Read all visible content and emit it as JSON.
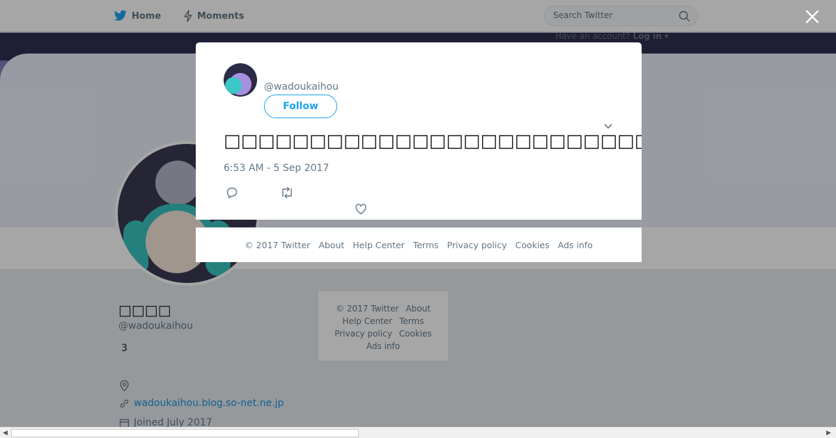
{
  "topnav": {
    "home_label": "Home",
    "moments_label": "Moments",
    "search_placeholder": "Search Twitter",
    "have_account": "Have an account?",
    "login_label": "Log in"
  },
  "profile": {
    "name": "□□□□",
    "handle": "@wadoukaihou",
    "count": "3",
    "url": "wadoukaihou.blog.so-net.ne.jp",
    "joined": "Joined July 2017"
  },
  "side_footer": {
    "copyright": "© 2017 Twitter",
    "about": "About",
    "help": "Help Center",
    "terms": "Terms",
    "privacy": "Privacy policy",
    "cookies": "Cookies",
    "ads": "Ads info"
  },
  "tweet": {
    "handle": "@wadoukaihou",
    "follow_label": "Follow",
    "text": "□□□□□□□□□□□□□□□□□□□□□□□□□□□□□□□□□□□□□□□□□□□□□□□□□□□□□□□□□□□",
    "timestamp": "6:53 AM - 5 Sep 2017"
  },
  "modal_footer": {
    "copyright": "© 2017 Twitter",
    "about": "About",
    "help": "Help Center",
    "terms": "Terms",
    "privacy": "Privacy policy",
    "cookies": "Cookies",
    "ads": "Ads info"
  },
  "colors": {
    "brand": "#1da1f2",
    "link": "#1b95e0",
    "muted": "#657786"
  },
  "icons": [
    "twitter-bird-icon",
    "moments-bolt-icon",
    "search-icon",
    "close-icon",
    "chevron-down-icon",
    "reply-icon",
    "retweet-icon",
    "like-heart-icon",
    "location-icon",
    "link-icon",
    "calendar-icon"
  ]
}
